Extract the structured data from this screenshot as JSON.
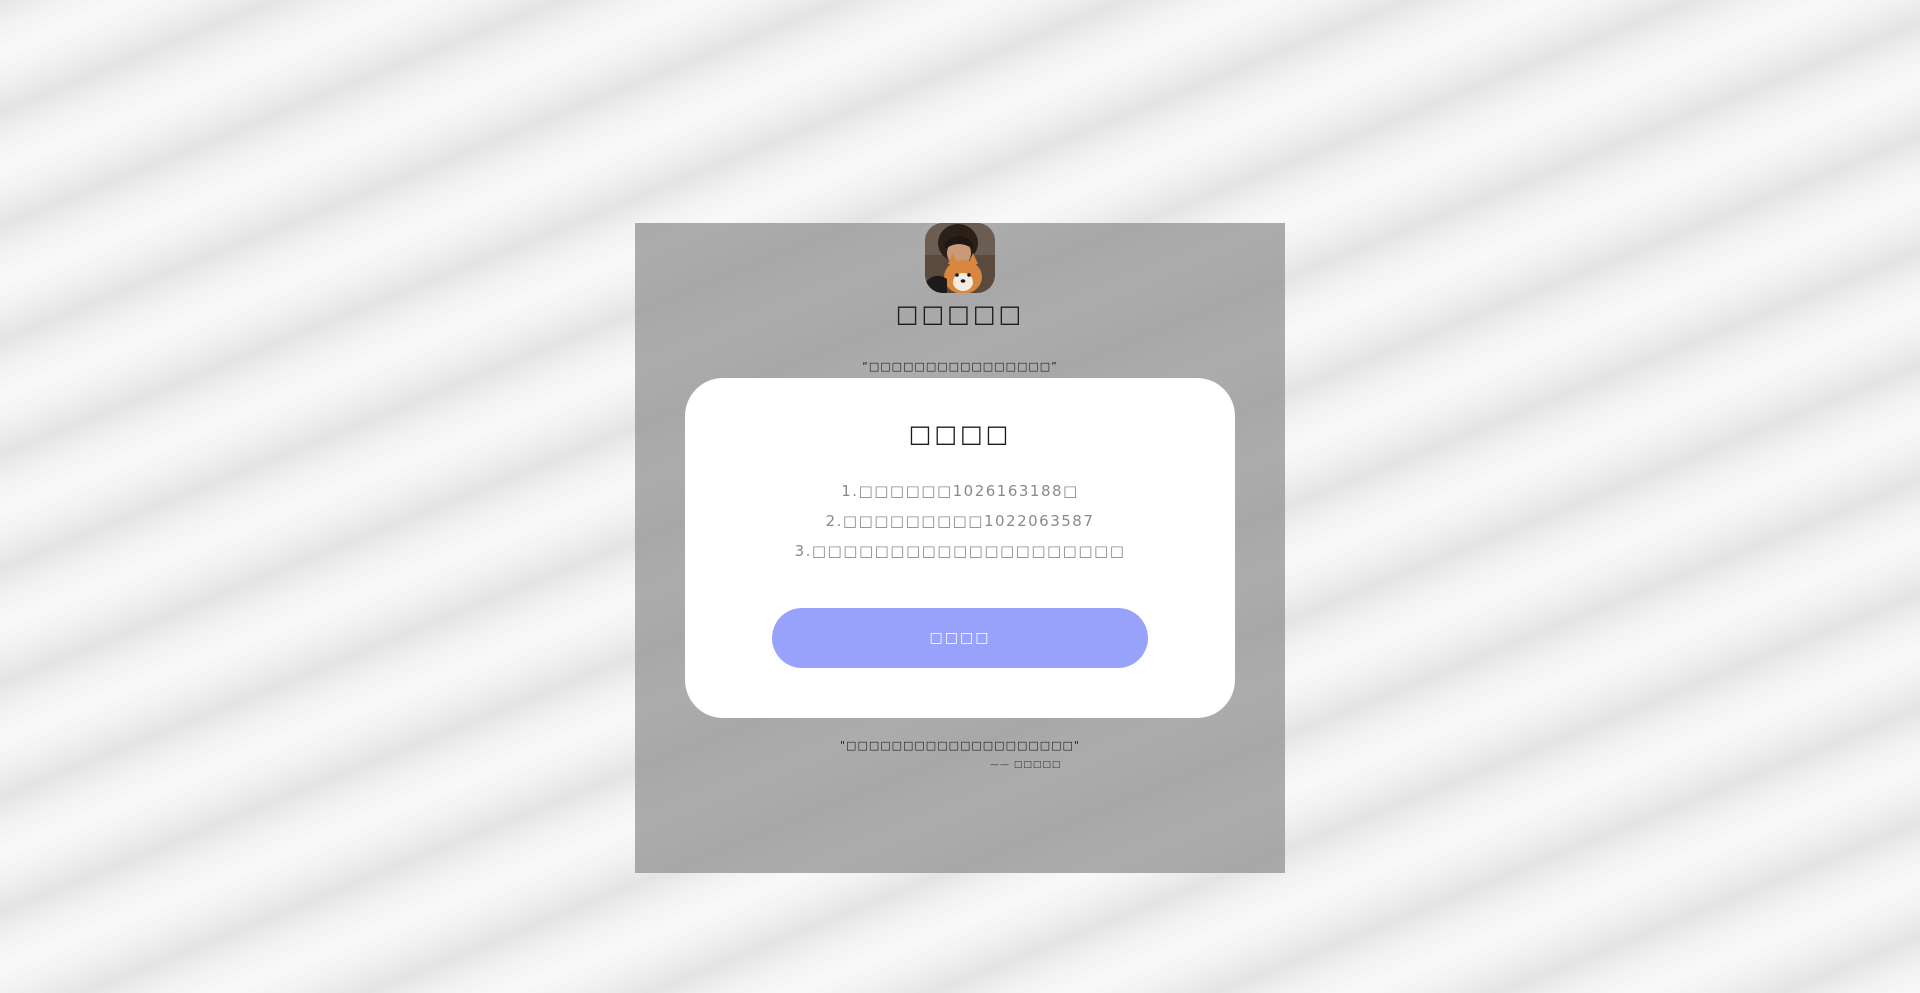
{
  "profile": {
    "site_name": "□□□□□",
    "motto": "“□□□□□□□□□□□□□□□□”"
  },
  "notice": {
    "title": "□□□□",
    "items": [
      "1.□□□□□□1026163188□",
      "2.□□□□□□□□□1022063587",
      "3.□□□□□□□□□□□□□□□□□□□□"
    ],
    "confirm_label": "□□□□"
  },
  "quote": {
    "text": "\"□□□□□□□□□□□□□□□□□□□□\"",
    "author": "—— □□□□□"
  },
  "colors": {
    "backdrop": "#969696",
    "panel": "#ffffff",
    "button": "#98a2fa",
    "button_text": "#ffffff",
    "notice_text": "#8a8a8a"
  }
}
